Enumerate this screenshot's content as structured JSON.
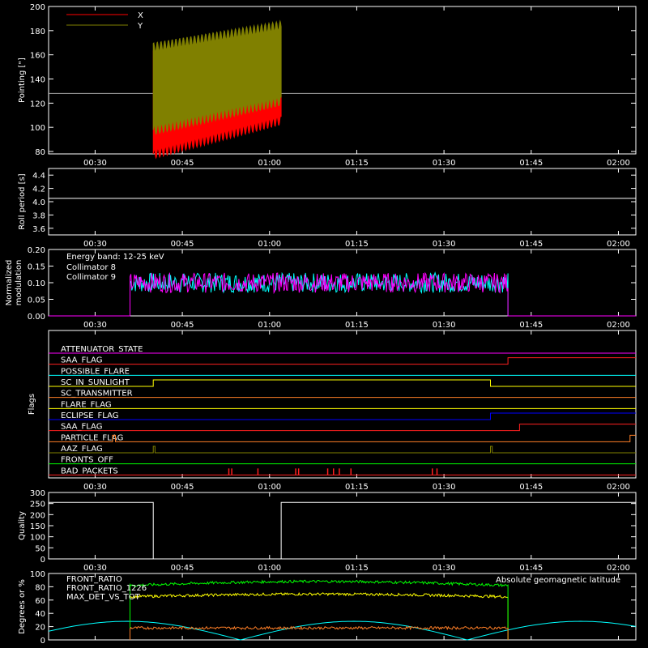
{
  "time_ticks": [
    "00:30",
    "00:45",
    "01:00",
    "01:15",
    "01:30",
    "01:45",
    "02:00"
  ],
  "colors": {
    "x": "#ff0000",
    "y": "#808000",
    "cyan": "#00ffff",
    "magenta": "#ff00ff",
    "red": "#ff2020",
    "orange": "#ff7f27",
    "yellow": "#ffff00",
    "blue": "#0000ff",
    "olive": "#808000",
    "green": "#00ff00",
    "white": "#ffffff"
  },
  "chart_data": [
    {
      "type": "line",
      "ylabel": "Pointing [\"]",
      "ylim": [
        78,
        200
      ],
      "yticks": [
        80,
        100,
        120,
        140,
        160,
        180,
        200
      ],
      "xlim": [
        "00:22",
        "02:03"
      ],
      "series": [
        {
          "name": "X",
          "x_start": "00:40",
          "x_end": "01:02",
          "low_start": 78,
          "low_end": 106,
          "high_start": 160,
          "high_end": 128
        },
        {
          "name": "Y",
          "x_start": "00:40",
          "x_end": "01:02",
          "low_start": 98,
          "low_end": 122,
          "high_start": 166,
          "high_end": 184
        }
      ],
      "reference_line": 128
    },
    {
      "type": "line",
      "ylabel": "Roll period [s]",
      "ylim": [
        3.5,
        4.5
      ],
      "yticks": [
        "3.6",
        "3.8",
        "4.0",
        "4.2",
        "4.4"
      ],
      "series": [
        {
          "name": "",
          "value": 4.05
        }
      ]
    },
    {
      "type": "line",
      "ylabel_line1": "Normalized",
      "ylabel_line2": "modulation",
      "ylim": [
        0.0,
        0.2
      ],
      "yticks": [
        "0.00",
        "0.05",
        "0.10",
        "0.15",
        "0.20"
      ],
      "annotation": "Energy band: 12-25 keV",
      "series": [
        {
          "name": "Collimator 8",
          "x_start": "00:36",
          "x_end": "01:41",
          "mean": 0.1,
          "spread": 0.03
        },
        {
          "name": "Collimator 9",
          "x_start": "00:36",
          "x_end": "01:41",
          "mean": 0.1,
          "spread": 0.03
        }
      ]
    },
    {
      "type": "line",
      "ylabel": "Flags",
      "flags": [
        {
          "name": "ATTENUATOR_STATE",
          "color": "#ff00ff",
          "transitions": []
        },
        {
          "name": "SAA_FLAG",
          "color": "#ff2020",
          "transitions": [
            [
              "01:41",
              1
            ]
          ]
        },
        {
          "name": "POSSIBLE_FLARE",
          "color": "#00ffff",
          "transitions": []
        },
        {
          "name": "SC_IN_SUNLIGHT",
          "color": "#ffff00",
          "transitions": [
            [
              "00:40",
              1
            ],
            [
              "01:38",
              0
            ]
          ]
        },
        {
          "name": "SC_TRANSMITTER",
          "color": "#ff7f27",
          "transitions": []
        },
        {
          "name": "FLARE_FLAG",
          "color": "#ffff00",
          "transitions": []
        },
        {
          "name": "ECLIPSE_FLAG",
          "color": "#0000ff",
          "transitions": [
            [
              "00:40",
              0
            ],
            [
              "01:38",
              1
            ]
          ]
        },
        {
          "name": "SAA_FLAG",
          "color": "#ff2020",
          "transitions": [
            [
              "01:43",
              1
            ]
          ]
        },
        {
          "name": "PARTICLE_FLAG",
          "color": "#ff7f27",
          "transitions": [
            [
              "00:33",
              1
            ],
            [
              "00:33.5",
              0
            ],
            [
              "02:02",
              1
            ]
          ]
        },
        {
          "name": "AAZ_FLAG",
          "color": "#808000",
          "transitions": [
            [
              "00:40",
              1
            ],
            [
              "00:40.3",
              0
            ],
            [
              "01:38",
              1
            ],
            [
              "01:38.3",
              0
            ]
          ]
        },
        {
          "name": "FRONTS_OFF",
          "color": "#00ff00",
          "transitions": []
        },
        {
          "name": "BAD_PACKETS",
          "color": "#ff2020",
          "spikes": [
            "00:53",
            "00:53.5",
            "00:58",
            "01:04.5",
            "01:05",
            "01:10",
            "01:11",
            "01:12",
            "01:14",
            "01:28",
            "01:28.8"
          ]
        }
      ]
    },
    {
      "type": "line",
      "ylabel": "Quality",
      "ylim": [
        0,
        300
      ],
      "yticks": [
        0,
        50,
        100,
        150,
        200,
        250,
        300
      ],
      "segments": [
        {
          "x_start": "00:22",
          "x_end": "00:40",
          "value": 255
        },
        {
          "x_start": "01:02",
          "x_end": "02:03",
          "value": 255
        }
      ]
    },
    {
      "type": "line",
      "ylabel": "Degrees or %",
      "ylim": [
        0,
        100
      ],
      "yticks": [
        0,
        20,
        40,
        60,
        80,
        100
      ],
      "series": [
        {
          "name": "FRONT_RATIO",
          "color": "#ffff00",
          "x_start": "00:36",
          "x_end": "01:41",
          "value": 65
        },
        {
          "name": "FRONT_RATIO_1226",
          "color": "#00ff00",
          "x_start": "00:36",
          "x_end": "01:41",
          "value": 82
        },
        {
          "name": "MAX_DET_VS_TOT",
          "color": "#ff7f27",
          "x_start": "00:36",
          "x_end": "01:41",
          "value": 18
        },
        {
          "name": "Absolute geomagnetic latitude",
          "color": "#00ffff",
          "period_min": 26,
          "max": 28
        }
      ]
    }
  ]
}
